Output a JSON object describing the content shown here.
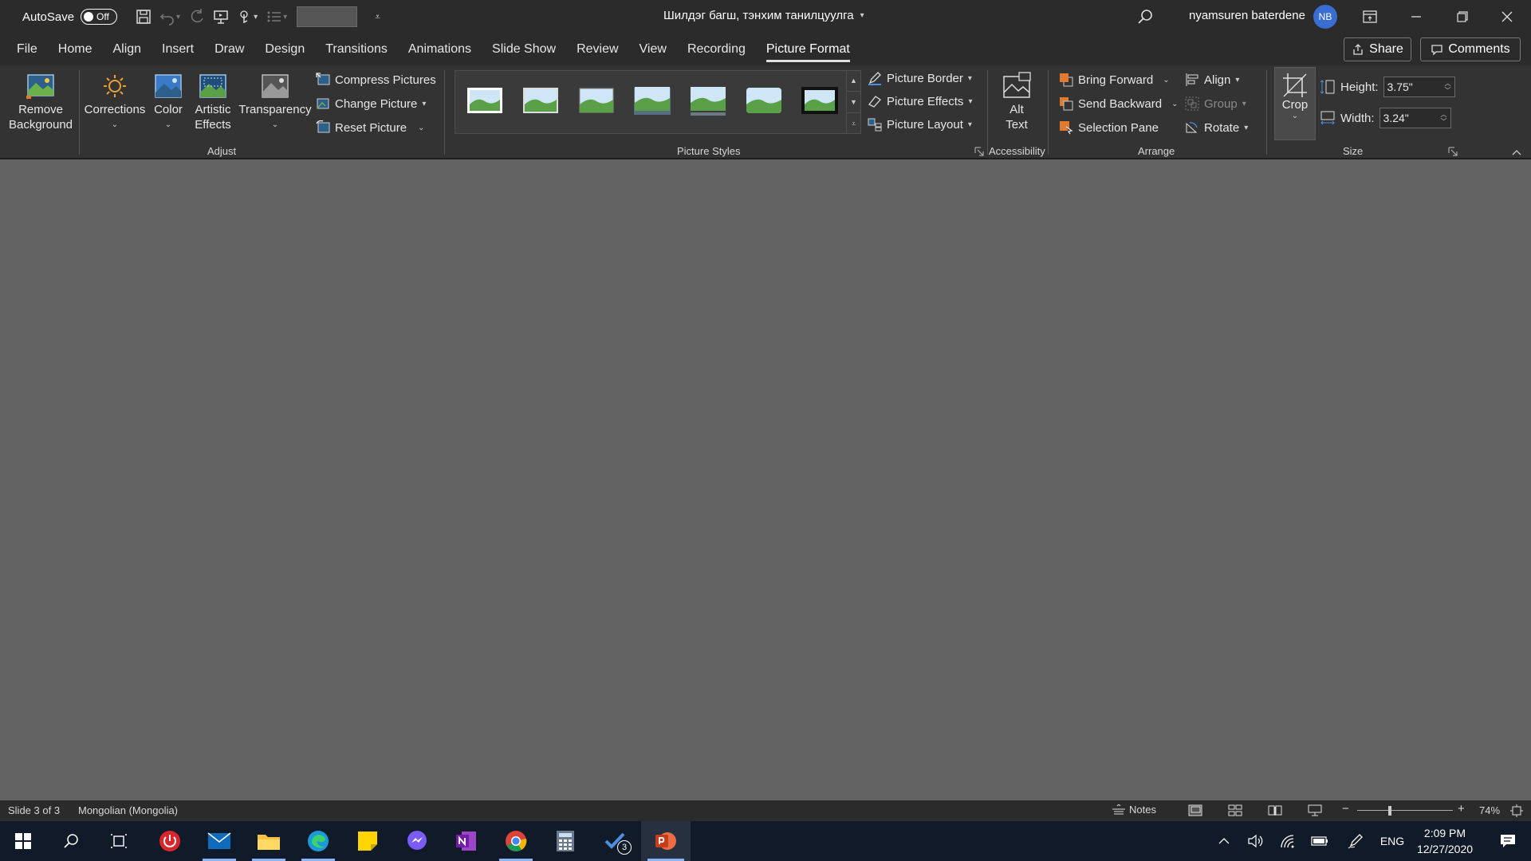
{
  "titlebar": {
    "autosave_label": "AutoSave",
    "autosave_state": "Off",
    "doc_title": "Шилдэг багш, тэнхим танилцуулга",
    "user_name": "nyamsuren baterdene",
    "user_initials": "NB"
  },
  "tabs": [
    {
      "label": "File"
    },
    {
      "label": "Home"
    },
    {
      "label": "Align"
    },
    {
      "label": "Insert"
    },
    {
      "label": "Draw"
    },
    {
      "label": "Design"
    },
    {
      "label": "Transitions"
    },
    {
      "label": "Animations"
    },
    {
      "label": "Slide Show"
    },
    {
      "label": "Review"
    },
    {
      "label": "View"
    },
    {
      "label": "Recording"
    },
    {
      "label": "Picture Format",
      "active": true
    }
  ],
  "share_label": "Share",
  "comments_label": "Comments",
  "ribbon": {
    "adjust": {
      "label": "Adjust",
      "remove_background": [
        "Remove",
        "Background"
      ],
      "corrections": "Corrections",
      "color": "Color",
      "artistic_effects": [
        "Artistic",
        "Effects"
      ],
      "transparency": "Transparency",
      "compress_pictures": "Compress Pictures",
      "change_picture": "Change Picture",
      "reset_picture": "Reset Picture"
    },
    "picture_styles": {
      "label": "Picture Styles",
      "picture_border": "Picture Border",
      "picture_effects": "Picture Effects",
      "picture_layout": "Picture Layout"
    },
    "accessibility": {
      "label": "Accessibility",
      "alt_text": [
        "Alt",
        "Text"
      ]
    },
    "arrange": {
      "label": "Arrange",
      "bring_forward": "Bring Forward",
      "send_backward": "Send Backward",
      "selection_pane": "Selection Pane",
      "align": "Align",
      "group": "Group",
      "rotate": "Rotate"
    },
    "size": {
      "label": "Size",
      "crop": "Crop",
      "height_label": "Height:",
      "height_value": "3.75\"",
      "width_label": "Width:",
      "width_value": "3.24\""
    }
  },
  "statusbar": {
    "slide_info": "Slide 3 of 3",
    "language": "Mongolian (Mongolia)",
    "notes": "Notes",
    "zoom": "74%"
  },
  "taskbar": {
    "todo_badge": "3",
    "language": "ENG",
    "time": "2:09 PM",
    "date": "12/27/2020"
  },
  "colors": {
    "titlebar_bg": "#2b2b2b",
    "ribbon_bg": "#333333",
    "canvas_bg": "#636363",
    "taskbar_bg": "#101a28",
    "avatar": "#3a6dd1"
  }
}
